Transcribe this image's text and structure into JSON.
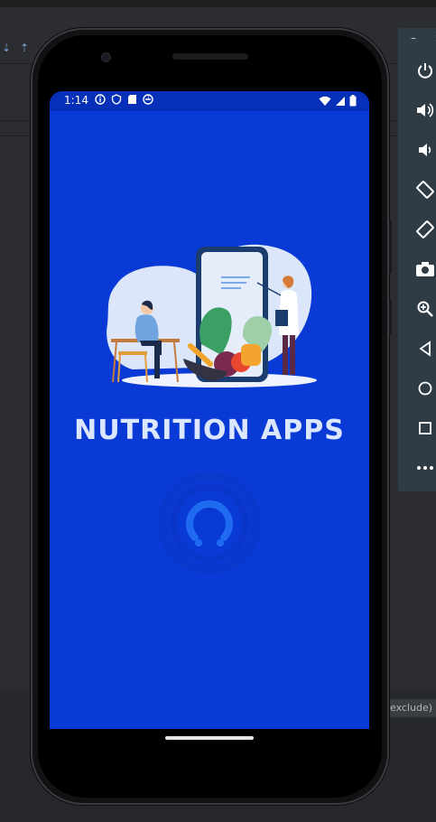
{
  "ide": {
    "bottom_tag": "exclude)"
  },
  "emulator_toolbar": {
    "window_controls": [
      "–",
      "×"
    ],
    "buttons": [
      {
        "name": "power-icon"
      },
      {
        "name": "volume-up-icon"
      },
      {
        "name": "volume-down-icon"
      },
      {
        "name": "rotate-left-icon"
      },
      {
        "name": "rotate-right-icon"
      },
      {
        "name": "camera-icon"
      },
      {
        "name": "zoom-icon"
      },
      {
        "name": "back-icon"
      },
      {
        "name": "home-icon"
      },
      {
        "name": "overview-icon"
      },
      {
        "name": "more-icon"
      }
    ]
  },
  "status_bar": {
    "time": "1:14"
  },
  "splash": {
    "title": "NUTRITION APPS"
  },
  "colors": {
    "screen_bg": "#0a3ad6",
    "status_bg": "#0730b8",
    "title": "#dbe6ff",
    "loader": "#1e6bf0"
  }
}
